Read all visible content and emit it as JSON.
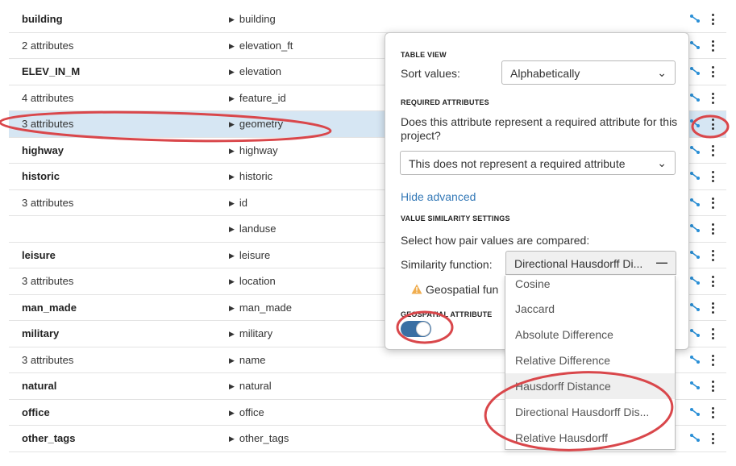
{
  "rows": [
    {
      "name": "building",
      "bold": true,
      "attr": "building"
    },
    {
      "name": "2 attributes",
      "bold": false,
      "attr": "elevation_ft"
    },
    {
      "name": "ELEV_IN_M",
      "bold": true,
      "attr": "elevation"
    },
    {
      "name": "4 attributes",
      "bold": false,
      "attr": "feature_id"
    },
    {
      "name": "3 attributes",
      "bold": false,
      "attr": "geometry",
      "selected": true
    },
    {
      "name": "highway",
      "bold": true,
      "attr": "highway"
    },
    {
      "name": "historic",
      "bold": true,
      "attr": "historic"
    },
    {
      "name": "3 attributes",
      "bold": false,
      "attr": "id"
    },
    {
      "name": "",
      "bold": false,
      "attr": "landuse"
    },
    {
      "name": "leisure",
      "bold": true,
      "attr": "leisure"
    },
    {
      "name": "3 attributes",
      "bold": false,
      "attr": "location"
    },
    {
      "name": "man_made",
      "bold": true,
      "attr": "man_made"
    },
    {
      "name": "military",
      "bold": true,
      "attr": "military"
    },
    {
      "name": "3 attributes",
      "bold": false,
      "attr": "name"
    },
    {
      "name": "natural",
      "bold": true,
      "attr": "natural"
    },
    {
      "name": "office",
      "bold": true,
      "attr": "office"
    },
    {
      "name": "other_tags",
      "bold": true,
      "attr": "other_tags"
    }
  ],
  "panel": {
    "table_view_heading": "TABLE VIEW",
    "sort_label": "Sort values:",
    "sort_value": "Alphabetically",
    "required_heading": "REQUIRED ATTRIBUTES",
    "required_question": "Does this attribute represent a required attribute for this project?",
    "required_value": "This does not represent a required attribute",
    "hide_advanced": "Hide advanced",
    "similarity_heading": "VALUE SIMILARITY SETTINGS",
    "similarity_prompt": "Select how pair values are compared:",
    "similarity_label": "Similarity function:",
    "similarity_value": "Directional Hausdorff Di...",
    "warning_text": "Geospatial fun",
    "geospatial_heading": "GEOSPATIAL ATTRIBUTE"
  },
  "dropdown_options": [
    "Cosine",
    "Jaccard",
    "Absolute Difference",
    "Relative Difference",
    "Hausdorff Distance",
    "Directional Hausdorff Dis...",
    "Relative Hausdorff"
  ],
  "icons": {
    "row_link": "link-icon",
    "row_menu": "kebab-menu-icon",
    "warning": "warning-icon",
    "chevron": "chevron-down-icon"
  },
  "colors": {
    "link_blue": "#3479b7",
    "selected_row": "#d6e6f3",
    "toggle_on": "#3a6fa3",
    "annotation_red": "#d9474b",
    "warning": "#f0ad4e"
  }
}
